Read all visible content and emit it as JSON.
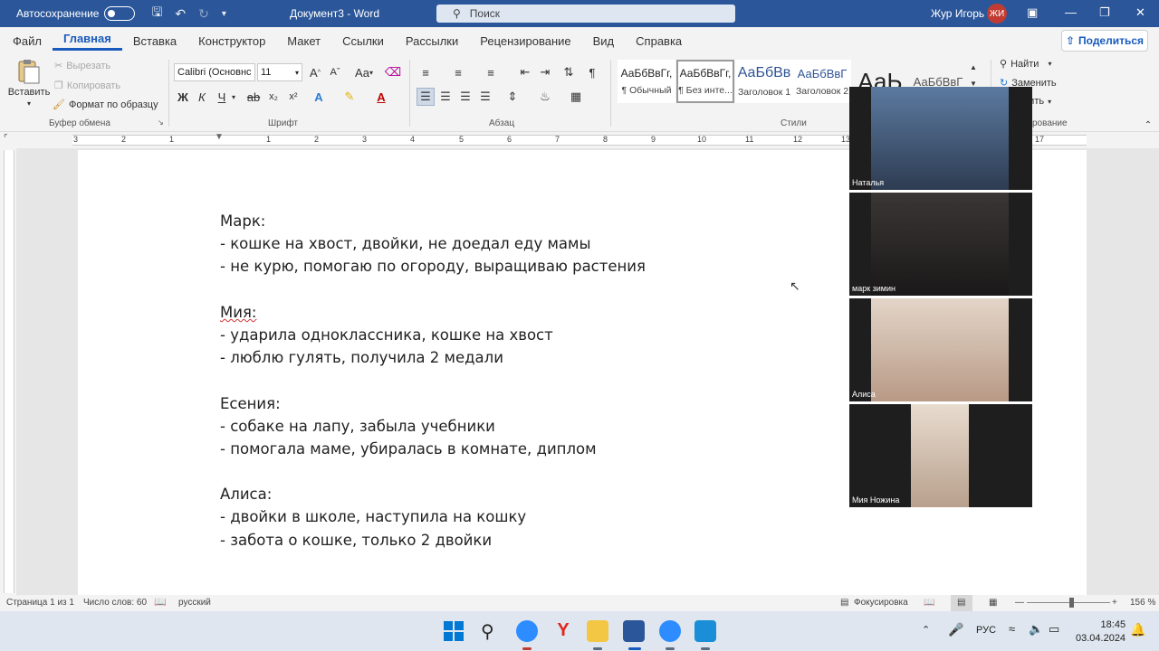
{
  "titlebar": {
    "autosave_label": "Автосохранение",
    "doc_title": "Документ3 - Word",
    "search_placeholder": "Поиск",
    "user_name": "Жур Игорь",
    "user_initials": "ЖИ"
  },
  "menu": {
    "tabs": [
      "Файл",
      "Главная",
      "Вставка",
      "Конструктор",
      "Макет",
      "Ссылки",
      "Рассылки",
      "Рецензирование",
      "Вид",
      "Справка"
    ],
    "active": "Главная",
    "share": "Поделиться"
  },
  "ribbon": {
    "clipboard": {
      "paste": "Вставить",
      "cut": "Вырезать",
      "copy": "Копировать",
      "format_painter": "Формат по образцу",
      "label": "Буфер обмена"
    },
    "font": {
      "name": "Calibri (Основнс",
      "size": "11",
      "label": "Шрифт",
      "bold": "Ж",
      "italic": "К",
      "underline": "Ч",
      "strike": "ab",
      "grow": "A",
      "case": "Aa"
    },
    "paragraph": {
      "label": "Абзац"
    },
    "styles": {
      "label": "Стили",
      "items": [
        {
          "sample": "АаБбВвГг,",
          "name": "¶ Обычный"
        },
        {
          "sample": "АаБбВвГг,",
          "name": "¶ Без инте..."
        },
        {
          "sample": "АаБбВв",
          "name": "Заголовок 1"
        },
        {
          "sample": "АаБбВвГ",
          "name": "Заголовок 2"
        },
        {
          "sample": "АаЬ",
          "name": ""
        },
        {
          "sample": "АаБбВвГ",
          "name": ""
        }
      ]
    },
    "editing": {
      "find": "Найти",
      "replace": "Заменить",
      "select": "елить",
      "label": "рование"
    }
  },
  "ruler": {
    "numbers": [
      "3",
      "2",
      "1",
      "1",
      "2",
      "3",
      "4",
      "5",
      "6",
      "7",
      "8",
      "9",
      "10",
      "11",
      "12",
      "13",
      "17"
    ]
  },
  "document": {
    "lines": [
      "Марк:",
      "- кошке на хвост, двойки, не доедал еду мамы",
      "- не курю, помогаю по огороду, выращиваю растения",
      "",
      "Мия:",
      "- ударила одноклассника, кошке на хвост",
      "- люблю гулять, получила 2 медали",
      "",
      "Есения:",
      "- собаке на лапу, забыла учебники",
      "- помогала маме, убиралась в комнате, диплом",
      "",
      "Алиса:",
      "- двойки в школе, наступила на кошку",
      "- забота о кошке, только 2 двойки"
    ]
  },
  "video_tiles": [
    {
      "name": "Наталья",
      "color": "#3d5170"
    },
    {
      "name": "марк зимин",
      "color": "#2c2a2a"
    },
    {
      "name": "Алиса",
      "color": "#c9b6a8"
    },
    {
      "name": "Мия Ножина",
      "color": "#d8c7b6"
    }
  ],
  "statusbar": {
    "page": "Страница 1 из 1",
    "words": "Число слов: 60",
    "language": "русский",
    "focus": "Фокусировка",
    "zoom": "156 %"
  },
  "taskbar": {
    "lang": "РУС",
    "time": "18:45",
    "date": "03.04.2024"
  },
  "colors": {
    "word_blue": "#2b579a",
    "accent": "#185abd"
  }
}
